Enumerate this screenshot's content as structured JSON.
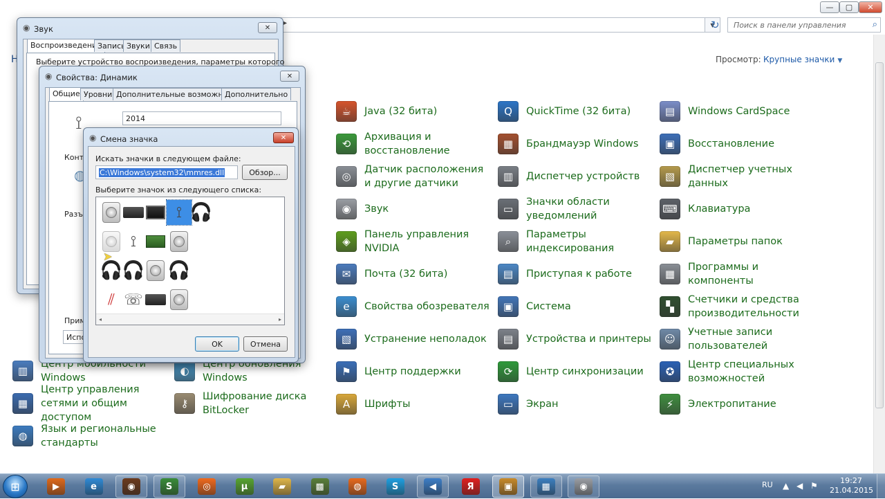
{
  "control_panel": {
    "search_placeholder": "Поиск в панели управления",
    "view_label": "Просмотр:",
    "view_value": "Крупные значки",
    "partial_letters": {
      "left_h": "Н"
    },
    "items_visible": [
      {
        "id": "java",
        "label": "Java (32 бита)",
        "color": "#d6542c",
        "glyph": "☕"
      },
      {
        "id": "quicktime",
        "label": "QuickTime (32 бита)",
        "color": "#2c76c8",
        "glyph": "Q"
      },
      {
        "id": "cardspace",
        "label": "Windows CardSpace",
        "color": "#7b8ec9",
        "glyph": "▤"
      },
      {
        "id": "backup",
        "label": "Архивация и восстановление",
        "color": "#3b9a3b",
        "glyph": "⟲"
      },
      {
        "id": "firewall",
        "label": "Брандмауэр Windows",
        "color": "#a4502f",
        "glyph": "▦"
      },
      {
        "id": "recovery",
        "label": "Восстановление",
        "color": "#3d6fb8",
        "glyph": "▣"
      },
      {
        "id": "location",
        "label": "Датчик расположения и другие датчики",
        "color": "#8a8f96",
        "glyph": "◎"
      },
      {
        "id": "devmgr",
        "label": "Диспетчер устройств",
        "color": "#7a7f86",
        "glyph": "▥"
      },
      {
        "id": "credmgr",
        "label": "Диспетчер учетных данных",
        "color": "#b59b4c",
        "glyph": "▧"
      },
      {
        "id": "sound",
        "label": "Звук",
        "color": "#9a9ea4",
        "glyph": "◉"
      },
      {
        "id": "tray",
        "label": "Значки области уведомлений",
        "color": "#6b7077",
        "glyph": "▭"
      },
      {
        "id": "keyboard",
        "label": "Клавиатура",
        "color": "#5d6168",
        "glyph": "⌨"
      },
      {
        "id": "nvidia",
        "label": "Панель управления NVIDIA",
        "color": "#5e9e1d",
        "glyph": "◈"
      },
      {
        "id": "indexing",
        "label": "Параметры индексирования",
        "color": "#8b9098",
        "glyph": "⌕"
      },
      {
        "id": "folders",
        "label": "Параметры папок",
        "color": "#e3b84a",
        "glyph": "▰"
      },
      {
        "id": "mail",
        "label": "Почта (32 бита)",
        "color": "#4b7bbd",
        "glyph": "✉"
      },
      {
        "id": "getstarted",
        "label": "Приступая к работе",
        "color": "#4c88c6",
        "glyph": "▤"
      },
      {
        "id": "programs",
        "label": "Программы и компоненты",
        "color": "#8a8f96",
        "glyph": "▦"
      },
      {
        "id": "ieoptions",
        "label": "Свойства обозревателя",
        "color": "#3b8ed0",
        "glyph": "e"
      },
      {
        "id": "system",
        "label": "Система",
        "color": "#4276b8",
        "glyph": "▣"
      },
      {
        "id": "perf",
        "label": "Счетчики и средства производительности",
        "color": "#2f4f2f",
        "glyph": "▚"
      },
      {
        "id": "troubleshoot",
        "label": "Устранение неполадок",
        "color": "#3d6fb8",
        "glyph": "▧"
      },
      {
        "id": "devices",
        "label": "Устройства и принтеры",
        "color": "#7d828a",
        "glyph": "▤"
      },
      {
        "id": "accounts",
        "label": "Учетные записи пользователей",
        "color": "#6f8aa8",
        "glyph": "☺"
      },
      {
        "id": "action",
        "label": "Центр поддержки",
        "color": "#3a6fb8",
        "glyph": "⚑"
      },
      {
        "id": "sync",
        "label": "Центр синхронизации",
        "color": "#2e9b3a",
        "glyph": "⟳"
      },
      {
        "id": "access",
        "label": "Центр специальных возможностей",
        "color": "#2a62b6",
        "glyph": "✪"
      },
      {
        "id": "fonts",
        "label": "Шрифты",
        "color": "#d9a83a",
        "glyph": "A"
      },
      {
        "id": "display",
        "label": "Экран",
        "color": "#3d78c0",
        "glyph": "▭"
      },
      {
        "id": "power",
        "label": "Электропитание",
        "color": "#3f8f3f",
        "glyph": "⚡"
      },
      {
        "id": "mobility",
        "label": "Центр мобильности Windows",
        "color": "#4a7dbf",
        "glyph": "▥"
      },
      {
        "id": "update",
        "label": "Центр обновления Windows",
        "color": "#4aa1d6",
        "glyph": "◐"
      },
      {
        "id": "network",
        "label": "Центр управления сетями и общим доступом",
        "color": "#3b6cb0",
        "glyph": "▦"
      },
      {
        "id": "bitlocker",
        "label": "Шифрование диска BitLocker",
        "color": "#9a8c72",
        "glyph": "⚷"
      },
      {
        "id": "region",
        "label": "Язык и региональные стандарты",
        "color": "#3c7cc0",
        "glyph": "◍"
      }
    ]
  },
  "sound_dialog": {
    "title": "Звук",
    "tabs": [
      "Воспроизведение",
      "Запись",
      "Звуки",
      "Связь"
    ],
    "description": "Выберите устройство воспроизведения, параметры которого"
  },
  "speaker_props": {
    "title": "Свойства: Динамик",
    "tabs": [
      "Общие",
      "Уровни",
      "Дополнительные возможности",
      "Дополнительно"
    ],
    "name_value": "2014",
    "label_controller": "Контр",
    "label_jacks": "Разъе",
    "label_apply": "Приме",
    "label_use": "Испол"
  },
  "change_icon": {
    "title": "Смена значка",
    "file_label": "Искать значки в следующем файле:",
    "file_value": "C:\\Windows\\system32\\mmres.dll",
    "browse": "Обзор...",
    "list_label": "Выберите значок из следующего списка:",
    "ok": "OK",
    "cancel": "Отмена",
    "icons": [
      "speaker",
      "receiver",
      "monitor",
      "microphone-stand",
      "headphones",
      "speaker-dim",
      "microphone",
      "sound-card",
      "speaker",
      "headset",
      "headphones",
      "speaker",
      "headphones",
      "rca-cables",
      "telephone-handset",
      "webcam",
      "speaker"
    ],
    "selected_index": 3
  },
  "taskbar": {
    "start": "start-orb",
    "apps": [
      {
        "name": "media-player",
        "color": "#e06a1c",
        "glyph": "▶",
        "state": "idle"
      },
      {
        "name": "internet-explorer",
        "color": "#2f8ad6",
        "glyph": "e",
        "state": "idle"
      },
      {
        "name": "five-nights-game",
        "color": "#6b3b1e",
        "glyph": "◉",
        "state": "open"
      },
      {
        "name": "sims-game",
        "color": "#3a8c3a",
        "glyph": "S",
        "state": "open"
      },
      {
        "name": "origin",
        "color": "#f06a1e",
        "glyph": "◎",
        "state": "idle"
      },
      {
        "name": "utorrent",
        "color": "#58a532",
        "glyph": "µ",
        "state": "idle"
      },
      {
        "name": "explorer",
        "color": "#e0b64a",
        "glyph": "▰",
        "state": "idle"
      },
      {
        "name": "minecraft",
        "color": "#5a7f3a",
        "glyph": "▩",
        "state": "idle"
      },
      {
        "name": "firefox",
        "color": "#e86a1e",
        "glyph": "◍",
        "state": "idle"
      },
      {
        "name": "skype",
        "color": "#1fa0e2",
        "glyph": "S",
        "state": "idle"
      },
      {
        "name": "sound-app",
        "color": "#3d7ec7",
        "glyph": "◀",
        "state": "open"
      },
      {
        "name": "yandex-browser",
        "color": "#e02020",
        "glyph": "Я",
        "state": "idle"
      },
      {
        "name": "screen-recorder",
        "color": "#c88a2a",
        "glyph": "▣",
        "state": "active"
      },
      {
        "name": "control-panel",
        "color": "#3c7fc0",
        "glyph": "▦",
        "state": "open"
      },
      {
        "name": "speaker-app",
        "color": "#9a9ea4",
        "glyph": "◉",
        "state": "open"
      }
    ],
    "lang": "RU",
    "time": "19:27",
    "date": "21.04.2015"
  }
}
